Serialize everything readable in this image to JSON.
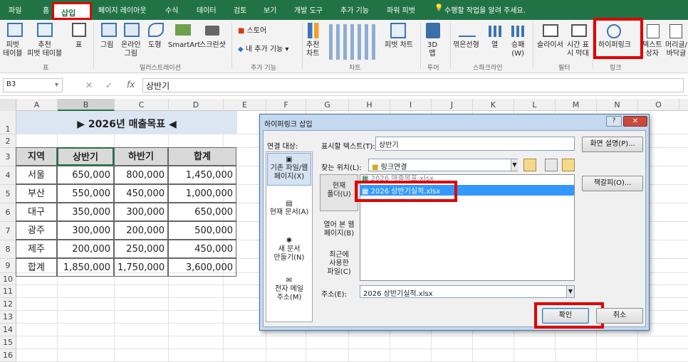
{
  "tabs": [
    "파일",
    "홈",
    "삽입",
    "페이지 레이아웃",
    "수식",
    "데이터",
    "검토",
    "보기",
    "개발 도구",
    "추가 기능",
    "파워 피벗"
  ],
  "tell_me": "수행할 작업을 알려 주세요.",
  "ribbon": {
    "pivot": "피벗\n테이블",
    "rec_pivot": "추천\n피벗 테이블",
    "table": "표",
    "picture": "그림",
    "online_picture": "온라인\n그림",
    "shapes": "도형",
    "smartart": "SmartArt",
    "screenshot": "스크린샷",
    "store": "스토어",
    "my_addins": "내 추가 기능",
    "rec_charts": "추천\n차트",
    "pivot_chart": "피벗 차트",
    "map3d": "3D\n맵",
    "line": "꺾은선형",
    "column": "열",
    "winloss": "승패\n(W)",
    "slicer": "슬라이서",
    "timeline": "시간 표\n시 막대",
    "hyperlink": "하이퍼링크",
    "textbox": "텍스트\n상자",
    "header": "머리글/\n바닥글",
    "groups": [
      "표",
      "일러스트레이션",
      "추가 기능",
      "차트",
      "투어",
      "스파크라인",
      "필터",
      "링크"
    ]
  },
  "formula_bar": {
    "name_box": "B3",
    "fx": "fx",
    "value": "상반기"
  },
  "columns": [
    "A",
    "B",
    "C",
    "D",
    "E",
    "F",
    "G",
    "H",
    "I",
    "J",
    "K",
    "L",
    "M",
    "N",
    "O"
  ],
  "rows": [
    "1",
    "2",
    "3",
    "4",
    "5",
    "6",
    "7",
    "8",
    "9",
    "10",
    "11",
    "12",
    "13",
    "14",
    "15",
    "16"
  ],
  "sheet": {
    "title": "▶ 2026년 매출목표 ◀",
    "headers": [
      "지역",
      "상반기",
      "하반기",
      "합계"
    ],
    "data": [
      [
        "서울",
        "650,000",
        "800,000",
        "1,450,000"
      ],
      [
        "부산",
        "550,000",
        "450,000",
        "1,000,000"
      ],
      [
        "대구",
        "350,000",
        "300,000",
        "650,000"
      ],
      [
        "광주",
        "300,000",
        "200,000",
        "500,000"
      ],
      [
        "제주",
        "200,000",
        "250,000",
        "450,000"
      ],
      [
        "합계",
        "1,850,000",
        "1,750,000",
        "3,600,000"
      ]
    ]
  },
  "dialog": {
    "title": "하이퍼링크 삽입",
    "link_to": "연결 대상:",
    "display_text_label": "표시할 텍스트(T):",
    "display_text": "상반기",
    "screen_tip": "화면 설명(P)...",
    "look_in_label": "찾는 위치(L):",
    "look_in": "링크연결",
    "bookmark": "책갈피(O)...",
    "nav": [
      "기존 파일/웹\n페이지(X)",
      "현재 문서(A)",
      "새 문서\n만들기(N)",
      "전자 메일\n주소(M)"
    ],
    "sub_nav": [
      "현재\n폴더(U)",
      "열어 본 웹\n페이지(B)",
      "최근에\n사용한\n파일(C)"
    ],
    "files": [
      "2026 매출목표.xlsx",
      "2026 상반기실적.xlsx"
    ],
    "address_label": "주소(E):",
    "address": "2026 상반기실적.xlsx",
    "ok": "확인",
    "cancel": "취소"
  },
  "colors": {
    "excel_green": "#217346",
    "highlight": "#e00000",
    "title_fill": "#dce6f2",
    "header_fill": "#d9d9d9"
  }
}
